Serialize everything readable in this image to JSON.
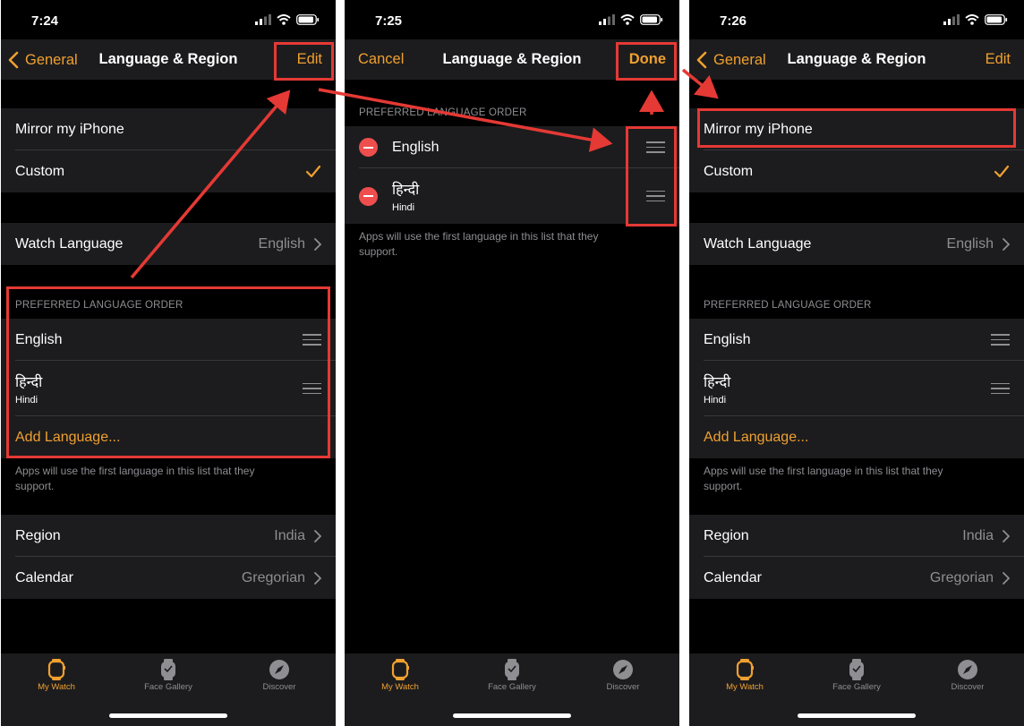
{
  "colors": {
    "accent": "#f0a030",
    "annotation": "#e53935",
    "delete": "#ef4e4e",
    "bg": "#000000",
    "cell": "#1c1c1e"
  },
  "icons": {
    "back": "chevron-left-icon",
    "disclosure": "chevron-right-icon",
    "check": "checkmark-icon",
    "reorder": "reorder-handle-icon",
    "delete": "minus-circle-icon",
    "signal": "signal-icon",
    "wifi": "wifi-icon",
    "battery": "battery-icon"
  },
  "screens": [
    {
      "time": "7:24",
      "nav": {
        "back": "General",
        "title": "Language & Region",
        "right": "Edit"
      },
      "mirror": "Mirror my iPhone",
      "custom": "Custom",
      "watch_language": {
        "label": "Watch Language",
        "value": "English"
      },
      "header": "PREFERRED LANGUAGE ORDER",
      "languages": [
        {
          "name": "English",
          "sub": ""
        },
        {
          "name": "हिन्दी",
          "sub": "Hindi"
        }
      ],
      "add_language": "Add Language...",
      "footnote": "Apps will use the first language in this list that they support.",
      "region": {
        "label": "Region",
        "value": "India"
      },
      "calendar": {
        "label": "Calendar",
        "value": "Gregorian"
      }
    },
    {
      "time": "7:25",
      "nav": {
        "back": "Cancel",
        "title": "Language & Region",
        "right": "Done"
      },
      "header": "PREFERRED LANGUAGE ORDER",
      "languages": [
        {
          "name": "English",
          "sub": ""
        },
        {
          "name": "हिन्दी",
          "sub": "Hindi"
        }
      ],
      "footnote": "Apps will use the first language in this list that they support."
    },
    {
      "time": "7:26",
      "nav": {
        "back": "General",
        "title": "Language & Region",
        "right": "Edit"
      },
      "mirror": "Mirror my iPhone",
      "custom": "Custom",
      "watch_language": {
        "label": "Watch Language",
        "value": "English"
      },
      "header": "PREFERRED LANGUAGE ORDER",
      "languages": [
        {
          "name": "English",
          "sub": ""
        },
        {
          "name": "हिन्दी",
          "sub": "Hindi"
        }
      ],
      "add_language": "Add Language...",
      "footnote": "Apps will use the first language in this list that they support.",
      "region": {
        "label": "Region",
        "value": "India"
      },
      "calendar": {
        "label": "Calendar",
        "value": "Gregorian"
      }
    }
  ],
  "tabs": [
    {
      "label": "My Watch",
      "icon": "watch-icon",
      "active": true
    },
    {
      "label": "Face Gallery",
      "icon": "face-gallery-icon",
      "active": false
    },
    {
      "label": "Discover",
      "icon": "compass-icon",
      "active": false
    }
  ]
}
